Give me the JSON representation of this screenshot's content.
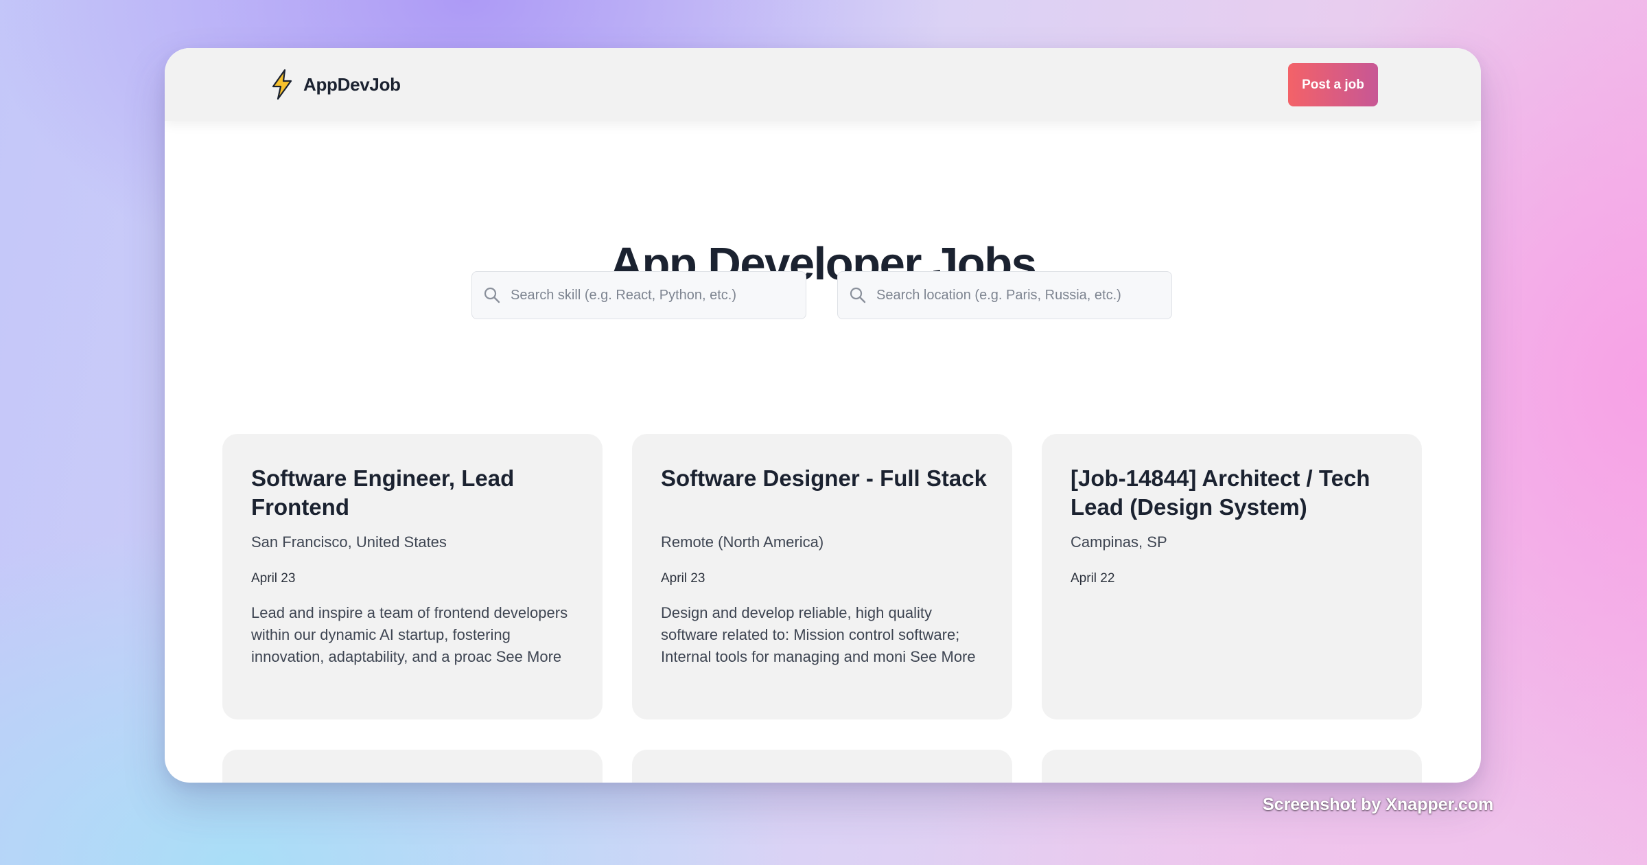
{
  "brand": {
    "name": "AppDevJob",
    "logo_icon": "lightning-bolt-icon",
    "logo_color": "#f7c12d"
  },
  "header": {
    "post_job_label": "Post a job",
    "post_job_gradient": [
      "#f36268",
      "#c75795"
    ]
  },
  "hero": {
    "title": "App Developer Jobs"
  },
  "search": {
    "skill_placeholder": "Search skill (e.g. React, Python, etc.)",
    "location_placeholder": "Search location (e.g. Paris, Russia, etc.)"
  },
  "jobs": [
    {
      "title": "Software Engineer, Lead Frontend",
      "location": "San Francisco, United States",
      "date": "April 23",
      "description": "Lead and inspire a team of frontend developers within our dynamic AI startup, fostering innovation, adaptability, and a proac",
      "see_more": "See More"
    },
    {
      "title": "Software Designer - Full Stack",
      "location": "Remote (North America)",
      "date": "April 23",
      "description": "Design and develop reliable, high quality software related to: Mission control software; Internal tools for managing and moni",
      "see_more": "See More"
    },
    {
      "title": "[Job-14844] Architect / Tech Lead (Design System)",
      "location": "Campinas, SP",
      "date": "April 22"
    }
  ],
  "watermark": "Screenshot by Xnapper.com"
}
